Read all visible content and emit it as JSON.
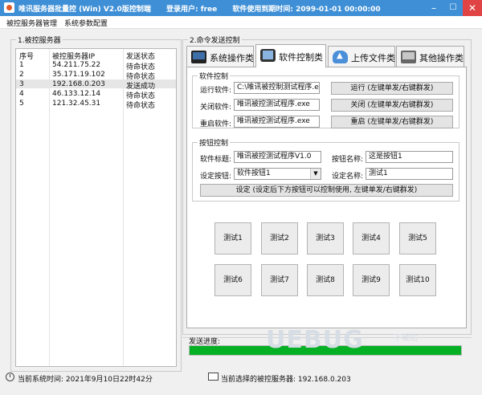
{
  "window": {
    "title": "唯讯服务器批量控 (Win) V2.0版控制端",
    "login_label": "登录用户: free",
    "expiry_label": "软件使用到期时间: 2099-01-01 00:00:00"
  },
  "menu": [
    "被控服务器管理",
    "系统参数配置"
  ],
  "left_panel": {
    "group_title": "1.被控服务器",
    "columns": [
      "序号",
      "被控服务器IP",
      "发送状态"
    ],
    "rows": [
      {
        "no": "1",
        "ip": "54.211.75.22",
        "status": "待命状态"
      },
      {
        "no": "2",
        "ip": "35.171.19.102",
        "status": "待命状态"
      },
      {
        "no": "3",
        "ip": "192.168.0.203",
        "status": "发送成功"
      },
      {
        "no": "4",
        "ip": "46.133.12.14",
        "status": "待命状态"
      },
      {
        "no": "5",
        "ip": "121.32.45.31",
        "status": "待命状态"
      }
    ],
    "selected_row": 2
  },
  "right_panel": {
    "group_title": "2.命令发送控制",
    "tabs": [
      {
        "label": "系统操作类",
        "icon": "monitor-icon"
      },
      {
        "label": "软件控制类",
        "icon": "phone-icon"
      },
      {
        "label": "上传文件类",
        "icon": "cloud-upload-icon"
      },
      {
        "label": "其他操作类",
        "icon": "other-icon"
      }
    ],
    "active_tab": 1,
    "software_control": {
      "title": "软件控制",
      "run_label": "运行软件:",
      "run_value": "C:\\唯讯被控制测试程序.exe",
      "run_button": "运行 (左键单发/右键群发)",
      "close_label": "关闭软件:",
      "close_value": "唯讯被控测试程序.exe",
      "close_button": "关闭 (左键单发/右键群发)",
      "restart_label": "重启软件:",
      "restart_value": "唯讯被控测试程序.exe",
      "restart_button": "重启 (左键单发/右键群发)"
    },
    "button_control": {
      "title": "按钮控制",
      "software_title_label": "软件标题:",
      "software_title_value": "唯讯被控测试程序V1.0",
      "button_name_label": "按钮名称:",
      "button_name_value": "这是按钮1",
      "set_button_label": "设定按钮:",
      "set_button_value": "软件按钮1",
      "set_name_label": "设定名称:",
      "set_name_value": "测试1",
      "set_button": "设定 (设定后下方按钮可以控制使用, 左键单发/右键群发)"
    },
    "test_buttons": [
      "测试1",
      "测试2",
      "测试3",
      "测试4",
      "测试5",
      "测试6",
      "测试7",
      "测试8",
      "测试9",
      "测试10"
    ],
    "progress_label": "发送进度:",
    "progress_fraction": 1.0,
    "progress_color": "#06b025"
  },
  "watermark": {
    "text": "UEBUG",
    "sub": "下载站"
  },
  "status": {
    "time_text": "当前系统时间: 2021年9月10日22时42分",
    "selected_server_text": "当前选择的被控服务器: 192.168.0.203"
  },
  "colors": {
    "titlebar": "#3e8fd6",
    "selected_row": "#e6e6e6",
    "close_button": "#e04343"
  }
}
